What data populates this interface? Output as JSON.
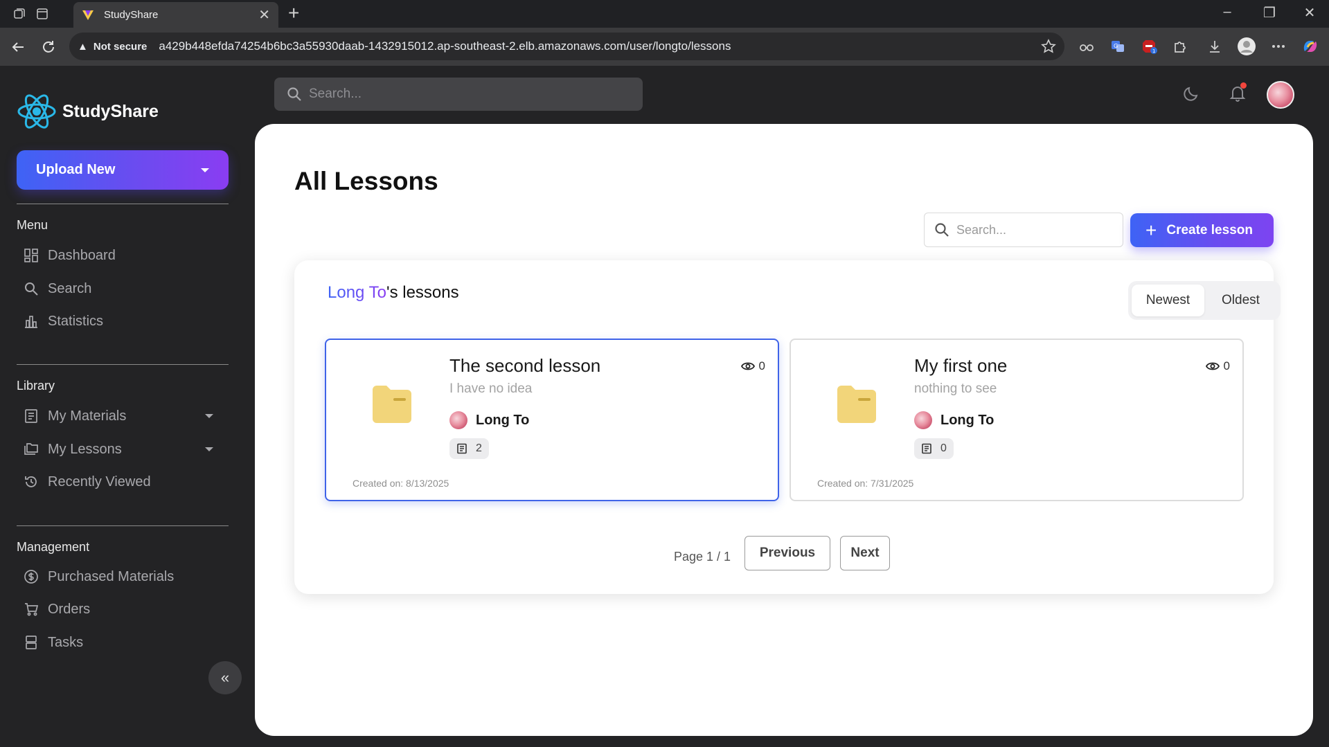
{
  "browser": {
    "tab_title": "StudyShare",
    "security_label": "Not secure",
    "url": "a429b448efda74254b6bc3a55930daab-1432915012.ap-southeast-2.elb.amazonaws.com/user/longto/lessons",
    "extension_badge": "1"
  },
  "sidebar": {
    "brand": "StudyShare",
    "upload_label": "Upload New",
    "sections": {
      "menu": {
        "title": "Menu",
        "items": [
          {
            "label": "Dashboard",
            "icon": "dashboard-icon"
          },
          {
            "label": "Search",
            "icon": "search-icon"
          },
          {
            "label": "Statistics",
            "icon": "bar-chart-icon"
          }
        ]
      },
      "library": {
        "title": "Library",
        "items": [
          {
            "label": "My Materials",
            "icon": "document-icon"
          },
          {
            "label": "My Lessons",
            "icon": "folders-icon"
          },
          {
            "label": "Recently Viewed",
            "icon": "history-icon"
          }
        ]
      },
      "management": {
        "title": "Management",
        "items": [
          {
            "label": "Purchased Materials",
            "icon": "dollar-circle-icon"
          },
          {
            "label": "Orders",
            "icon": "cart-icon"
          },
          {
            "label": "Tasks",
            "icon": "tasks-icon"
          }
        ]
      }
    },
    "collapse_glyph": "«"
  },
  "topbar": {
    "search_placeholder": "Search..."
  },
  "main": {
    "title": "All Lessons",
    "search_placeholder": "Search...",
    "create_label": "Create lesson",
    "panel": {
      "owner": "Long To",
      "title_suffix": "'s lessons",
      "sort_options": [
        "Newest",
        "Oldest"
      ],
      "active_sort": "Newest",
      "cards": [
        {
          "title": "The second lesson",
          "description": "I have no idea",
          "views": "0",
          "author": "Long To",
          "item_count": "2",
          "created": "Created on: 8/13/2025"
        },
        {
          "title": "My first one",
          "description": "nothing to see",
          "views": "0",
          "author": "Long To",
          "item_count": "0",
          "created": "Created on: 7/31/2025"
        }
      ],
      "pagination": {
        "page_text": "Page 1 / 1",
        "previous_label": "Previous",
        "next_label": "Next"
      }
    }
  },
  "colors": {
    "accent_start": "#3e63f5",
    "accent_end": "#8a3df2",
    "selected_border": "#3f63e8",
    "folder": "#f2d57a",
    "notification_dot": "#f2463d"
  }
}
